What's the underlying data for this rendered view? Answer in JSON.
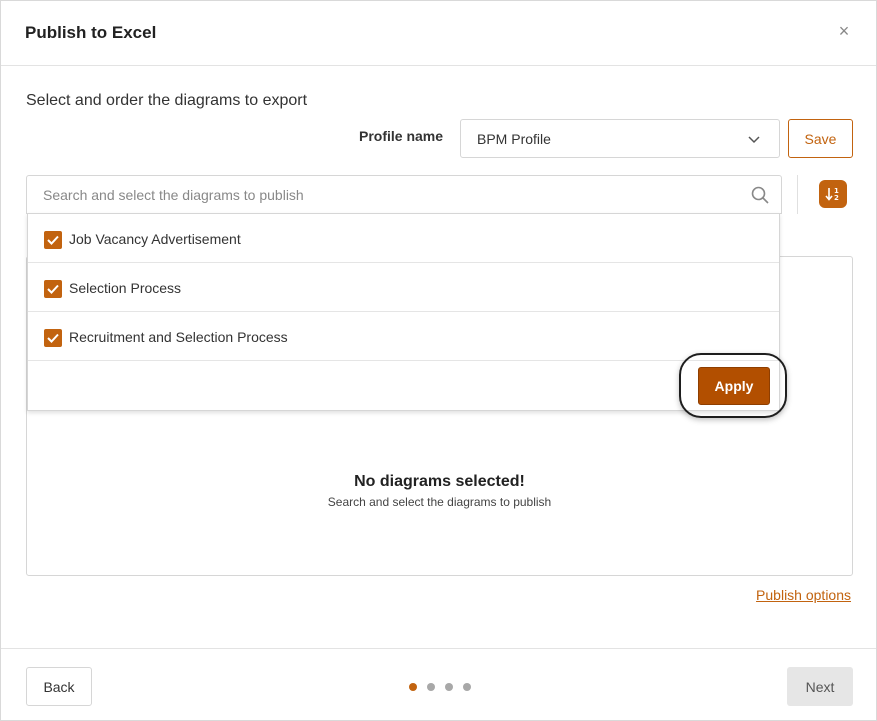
{
  "dialog": {
    "title": "Publish to Excel",
    "close_glyph": "×",
    "subtitle": "Select and order the diagrams to export"
  },
  "profile": {
    "label": "Profile name",
    "selected": "BPM Profile",
    "save_label": "Save"
  },
  "search": {
    "placeholder": "Search and select the diagrams to publish"
  },
  "dropdown": {
    "options": [
      {
        "label": "Job Vacancy Advertisement",
        "checked": true
      },
      {
        "label": "Selection Process",
        "checked": true
      },
      {
        "label": "Recruitment and Selection Process",
        "checked": true
      }
    ],
    "apply_label": "Apply"
  },
  "empty_state": {
    "title": "No diagrams selected!",
    "subtitle": "Search and select the diagrams to publish"
  },
  "publish_options_label": "Publish options",
  "footer": {
    "back_label": "Back",
    "next_label": "Next",
    "step_count": 4,
    "active_step": 1
  },
  "colors": {
    "accent": "#c2630f",
    "apply": "#b24f00",
    "disabled": "#e6e6e6",
    "dot_inactive": "#a8a8a8"
  },
  "icons": {
    "close": "close-icon",
    "chevron": "chevron-down-icon",
    "search": "search-icon",
    "sort": "sort-ascending-icon",
    "check": "check-icon"
  }
}
